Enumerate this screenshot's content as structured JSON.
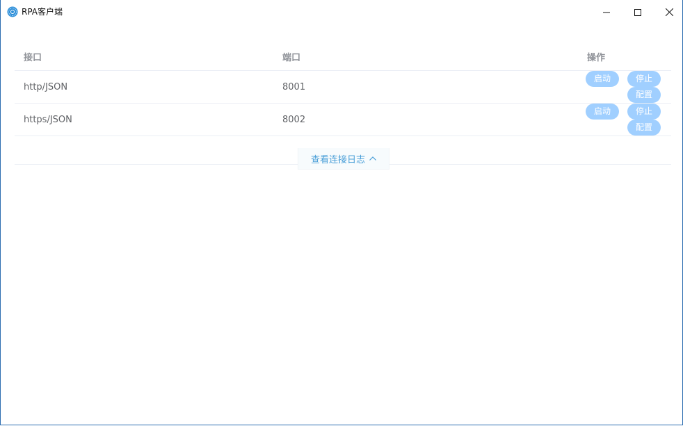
{
  "window": {
    "title": "RPA客户端",
    "icon": "globe-app-icon",
    "controls": {
      "minimize": "minimize-icon",
      "maximize": "maximize-icon",
      "close": "close-icon"
    }
  },
  "table": {
    "headers": {
      "interface": "接口",
      "port": "端口",
      "actions": "操作"
    },
    "rows": [
      {
        "interface": "http/JSON",
        "port": "8001",
        "start": "启动",
        "stop": "停止",
        "config": "配置"
      },
      {
        "interface": "https/JSON",
        "port": "8002",
        "start": "启动",
        "stop": "停止",
        "config": "配置"
      }
    ]
  },
  "log_toggle": {
    "label": "查看连接日志",
    "icon": "chevron-up-icon"
  },
  "colors": {
    "pill_bg": "#a0cfff",
    "header_text": "#909399",
    "cell_text": "#606266",
    "link": "#4a9fd8",
    "border": "#ebeef5"
  }
}
